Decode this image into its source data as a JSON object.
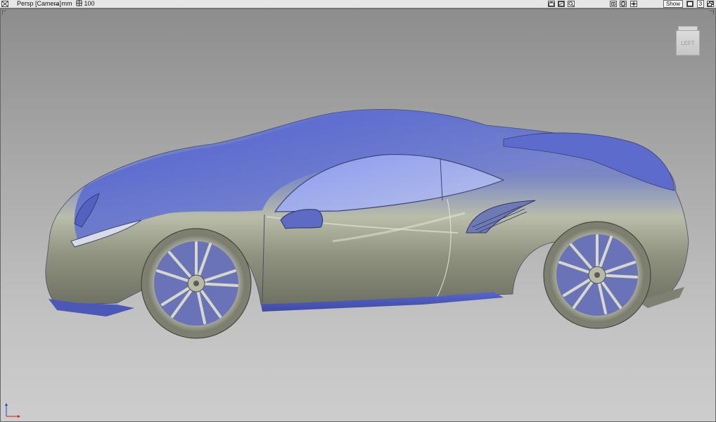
{
  "viewport_header": {
    "camera_label": "Persp [Camera]",
    "units_label": "mm",
    "scale_value": "100",
    "show_label": "Show",
    "layout_count": "3"
  },
  "viewcube": {
    "face_label": "LEFT"
  },
  "icons": {
    "close": "close-x-icon",
    "units": "arrows-horizontal-icon",
    "scale": "move-cross-icon",
    "camera": "camera-icon",
    "render": "render-icon",
    "zoom": "magnifier-icon",
    "fit": "fit-view-icon",
    "sphere": "sphere-icon",
    "pan": "pan-icon",
    "window": "window-icon",
    "maximize": "maximize-icon"
  },
  "colors": {
    "car_body": "#6c78c4",
    "car_metal": "#9ea092",
    "background_top": "#8d8d8d",
    "background_bottom": "#cdcdcd"
  }
}
